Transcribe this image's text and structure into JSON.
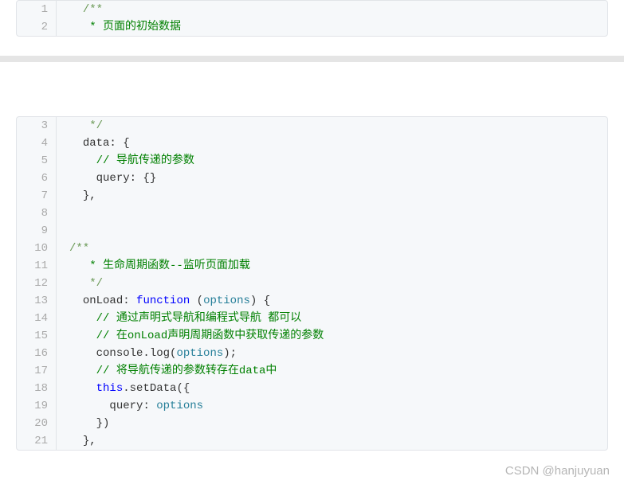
{
  "block1": {
    "lines": [
      {
        "n": 1,
        "tokens": [
          {
            "t": "  ",
            "c": ""
          },
          {
            "t": "/**",
            "c": "tok-comment"
          }
        ]
      },
      {
        "n": 2,
        "tokens": [
          {
            "t": "   ",
            "c": ""
          },
          {
            "t": "* 页面的初始数据",
            "c": "tok-comment-cn"
          }
        ]
      }
    ]
  },
  "block2": {
    "lines": [
      {
        "n": 3,
        "tokens": [
          {
            "t": "   ",
            "c": ""
          },
          {
            "t": "*/",
            "c": "tok-comment"
          }
        ]
      },
      {
        "n": 4,
        "tokens": [
          {
            "t": "  ",
            "c": ""
          },
          {
            "t": "data",
            "c": "tok-prop"
          },
          {
            "t": ": {",
            "c": "tok-punct"
          }
        ]
      },
      {
        "n": 5,
        "tokens": [
          {
            "t": "    ",
            "c": ""
          },
          {
            "t": "// 导航传递的参数",
            "c": "tok-comment-cn"
          }
        ]
      },
      {
        "n": 6,
        "tokens": [
          {
            "t": "    ",
            "c": ""
          },
          {
            "t": "query",
            "c": "tok-prop"
          },
          {
            "t": ": {}",
            "c": "tok-punct"
          }
        ]
      },
      {
        "n": 7,
        "tokens": [
          {
            "t": "  ",
            "c": ""
          },
          {
            "t": "},",
            "c": "tok-punct"
          }
        ]
      },
      {
        "n": 8,
        "tokens": []
      },
      {
        "n": 9,
        "tokens": []
      },
      {
        "n": 10,
        "tokens": [
          {
            "t": "/**",
            "c": "tok-comment"
          }
        ]
      },
      {
        "n": 11,
        "tokens": [
          {
            "t": "   ",
            "c": ""
          },
          {
            "t": "* 生命周期函数--监听页面加载",
            "c": "tok-comment-cn"
          }
        ]
      },
      {
        "n": 12,
        "tokens": [
          {
            "t": "   ",
            "c": ""
          },
          {
            "t": "*/",
            "c": "tok-comment"
          }
        ]
      },
      {
        "n": 13,
        "tokens": [
          {
            "t": "  ",
            "c": ""
          },
          {
            "t": "onLoad",
            "c": "tok-prop"
          },
          {
            "t": ": ",
            "c": "tok-punct"
          },
          {
            "t": "function",
            "c": "tok-keyword"
          },
          {
            "t": " (",
            "c": "tok-punct"
          },
          {
            "t": "options",
            "c": "tok-param"
          },
          {
            "t": ") {",
            "c": "tok-punct"
          }
        ]
      },
      {
        "n": 14,
        "tokens": [
          {
            "t": "    ",
            "c": ""
          },
          {
            "t": "// 通过声明式导航和编程式导航 都可以",
            "c": "tok-comment-cn"
          }
        ]
      },
      {
        "n": 15,
        "tokens": [
          {
            "t": "    ",
            "c": ""
          },
          {
            "t": "// 在onLoad声明周期函数中获取传递的参数",
            "c": "tok-comment-cn"
          }
        ]
      },
      {
        "n": 16,
        "tokens": [
          {
            "t": "    ",
            "c": ""
          },
          {
            "t": "console",
            "c": "tok-builtin"
          },
          {
            "t": ".",
            "c": "tok-punct"
          },
          {
            "t": "log",
            "c": "tok-func"
          },
          {
            "t": "(",
            "c": "tok-punct"
          },
          {
            "t": "options",
            "c": "tok-param"
          },
          {
            "t": ");",
            "c": "tok-punct"
          }
        ]
      },
      {
        "n": 17,
        "tokens": [
          {
            "t": "    ",
            "c": ""
          },
          {
            "t": "// 将导航传递的参数转存在data中",
            "c": "tok-comment-cn"
          }
        ]
      },
      {
        "n": 18,
        "tokens": [
          {
            "t": "    ",
            "c": ""
          },
          {
            "t": "this",
            "c": "tok-this"
          },
          {
            "t": ".",
            "c": "tok-punct"
          },
          {
            "t": "setData",
            "c": "tok-func"
          },
          {
            "t": "({",
            "c": "tok-punct"
          }
        ]
      },
      {
        "n": 19,
        "tokens": [
          {
            "t": "      ",
            "c": ""
          },
          {
            "t": "query",
            "c": "tok-prop"
          },
          {
            "t": ": ",
            "c": "tok-punct"
          },
          {
            "t": "options",
            "c": "tok-param"
          }
        ]
      },
      {
        "n": 20,
        "tokens": [
          {
            "t": "    ",
            "c": ""
          },
          {
            "t": "})",
            "c": "tok-punct"
          }
        ]
      },
      {
        "n": 21,
        "tokens": [
          {
            "t": "  ",
            "c": ""
          },
          {
            "t": "},",
            "c": "tok-punct"
          }
        ]
      }
    ]
  },
  "watermark": "CSDN @hanjuyuan"
}
